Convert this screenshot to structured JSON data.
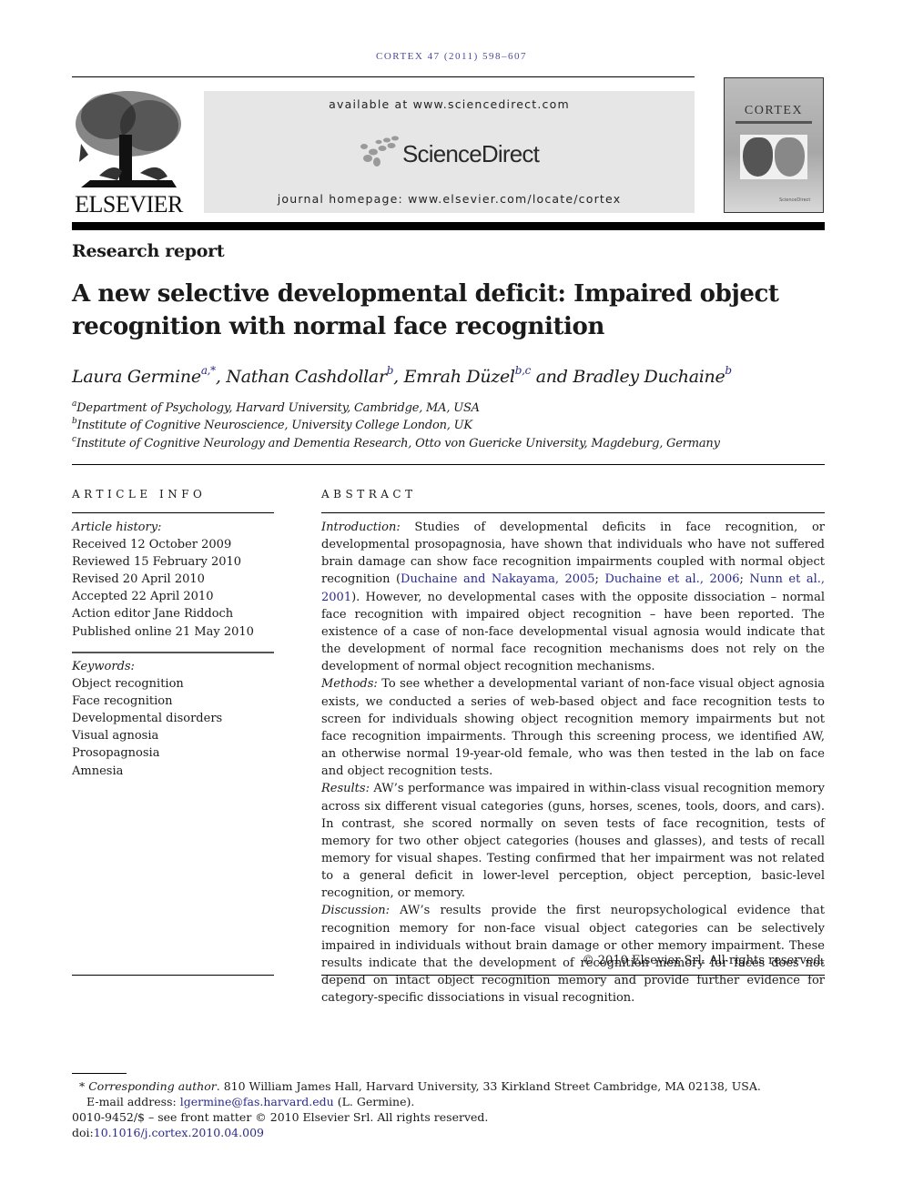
{
  "header": {
    "journal_reference": "CORTEX 47 (2011) 598–607",
    "publisher_logo_text": "ELSEVIER",
    "available_at": "available at www.sciencedirect.com",
    "sciencedirect_logo_text": "ScienceDirect",
    "journal_homepage": "journal homepage: www.elsevier.com/locate/cortex",
    "cover": {
      "title": "CORTEX",
      "publisher_mark": "ScienceDirect"
    }
  },
  "article": {
    "section_label": "Research report",
    "title": "A new selective developmental deficit: Impaired object recognition with normal face recognition",
    "authors": [
      {
        "name": "Laura Germine",
        "sup": "a,*",
        "sep": ", "
      },
      {
        "name": "Nathan Cashdollar",
        "sup": "b",
        "sep": ", "
      },
      {
        "name": "Emrah Düzel",
        "sup": "b,c",
        "sep": " and "
      },
      {
        "name": "Bradley Duchaine",
        "sup": "b",
        "sep": ""
      }
    ],
    "affiliations": [
      {
        "key": "a",
        "text": "Department of Psychology, Harvard University, Cambridge, MA, USA"
      },
      {
        "key": "b",
        "text": "Institute of Cognitive Neuroscience, University College London, UK"
      },
      {
        "key": "c",
        "text": "Institute of Cognitive Neurology and Dementia Research, Otto von Guericke University, Magdeburg, Germany"
      }
    ]
  },
  "article_info": {
    "heading": "ARTICLE INFO",
    "history_label": "Article history:",
    "history": [
      "Received 12 October 2009",
      "Reviewed 15 February 2010",
      "Revised 20 April 2010",
      "Accepted 22 April 2010",
      "Action editor Jane Riddoch",
      "Published online 21 May 2010"
    ],
    "keywords_label": "Keywords:",
    "keywords": [
      "Object recognition",
      "Face recognition",
      "Developmental disorders",
      "Visual agnosia",
      "Prosopagnosia",
      "Amnesia"
    ]
  },
  "abstract": {
    "heading": "ABSTRACT",
    "introduction": {
      "label": "Introduction:",
      "text_before": " Studies of developmental deficits in face recognition, or developmental prosopagnosia, have shown that individuals who have not suffered brain damage can show face recognition impairments coupled with normal object recognition (",
      "citations": [
        "Duchaine and Nakayama, 2005",
        "Duchaine et al., 2006",
        "Nunn et al., 2001"
      ],
      "text_after": "). However, no developmental cases with the opposite dissociation – normal face recognition with impaired object recognition – have been reported. The existence of a case of non-face developmental visual agnosia would indicate that the development of normal face recognition mechanisms does not rely on the development of normal object recognition mechanisms."
    },
    "methods": {
      "label": "Methods:",
      "text": " To see whether a developmental variant of non-face visual object agnosia exists, we conducted a series of web-based object and face recognition tests to screen for individuals showing object recognition memory impairments but not face recognition impairments. Through this screening process, we identified AW, an otherwise normal 19-year-old female, who was then tested in the lab on face and object recognition tests."
    },
    "results": {
      "label": "Results:",
      "text": " AW’s performance was impaired in within-class visual recognition memory across six different visual categories (guns, horses, scenes, tools, doors, and cars). In contrast, she scored normally on seven tests of face recognition, tests of memory for two other object categories (houses and glasses), and tests of recall memory for visual shapes. Testing confirmed that her impairment was not related to a general deficit in lower-level perception, object perception, basic-level recognition, or memory."
    },
    "discussion": {
      "label": "Discussion:",
      "text": " AW’s results provide the first neuropsychological evidence that recognition memory for non-face visual object categories can be selectively impaired in individuals without brain damage or other memory impairment. These results indicate that the development of recognition memory for faces does not depend on intact object recognition memory and provide further evidence for category-specific dissociations in visual recognition."
    },
    "copyright": "© 2010 Elsevier Srl. All rights reserved."
  },
  "footnotes": {
    "corresponding_marker": "*",
    "corresponding_label": "Corresponding author",
    "corresponding_text": ". 810 William James Hall, Harvard University, 33 Kirkland Street Cambridge, MA 02138, USA.",
    "email_label": "E-mail address: ",
    "email": "lgermine@fas.harvard.edu",
    "email_suffix": " (L. Germine).",
    "issn_line": "0010-9452/$ – see front matter © 2010 Elsevier Srl. All rights reserved.",
    "doi_label": "doi:",
    "doi": "10.1016/j.cortex.2010.04.009"
  },
  "colors": {
    "link": "#2a2a8a",
    "journal_ref": "#4a4a9a",
    "banner_bg": "#e6e6e6"
  }
}
